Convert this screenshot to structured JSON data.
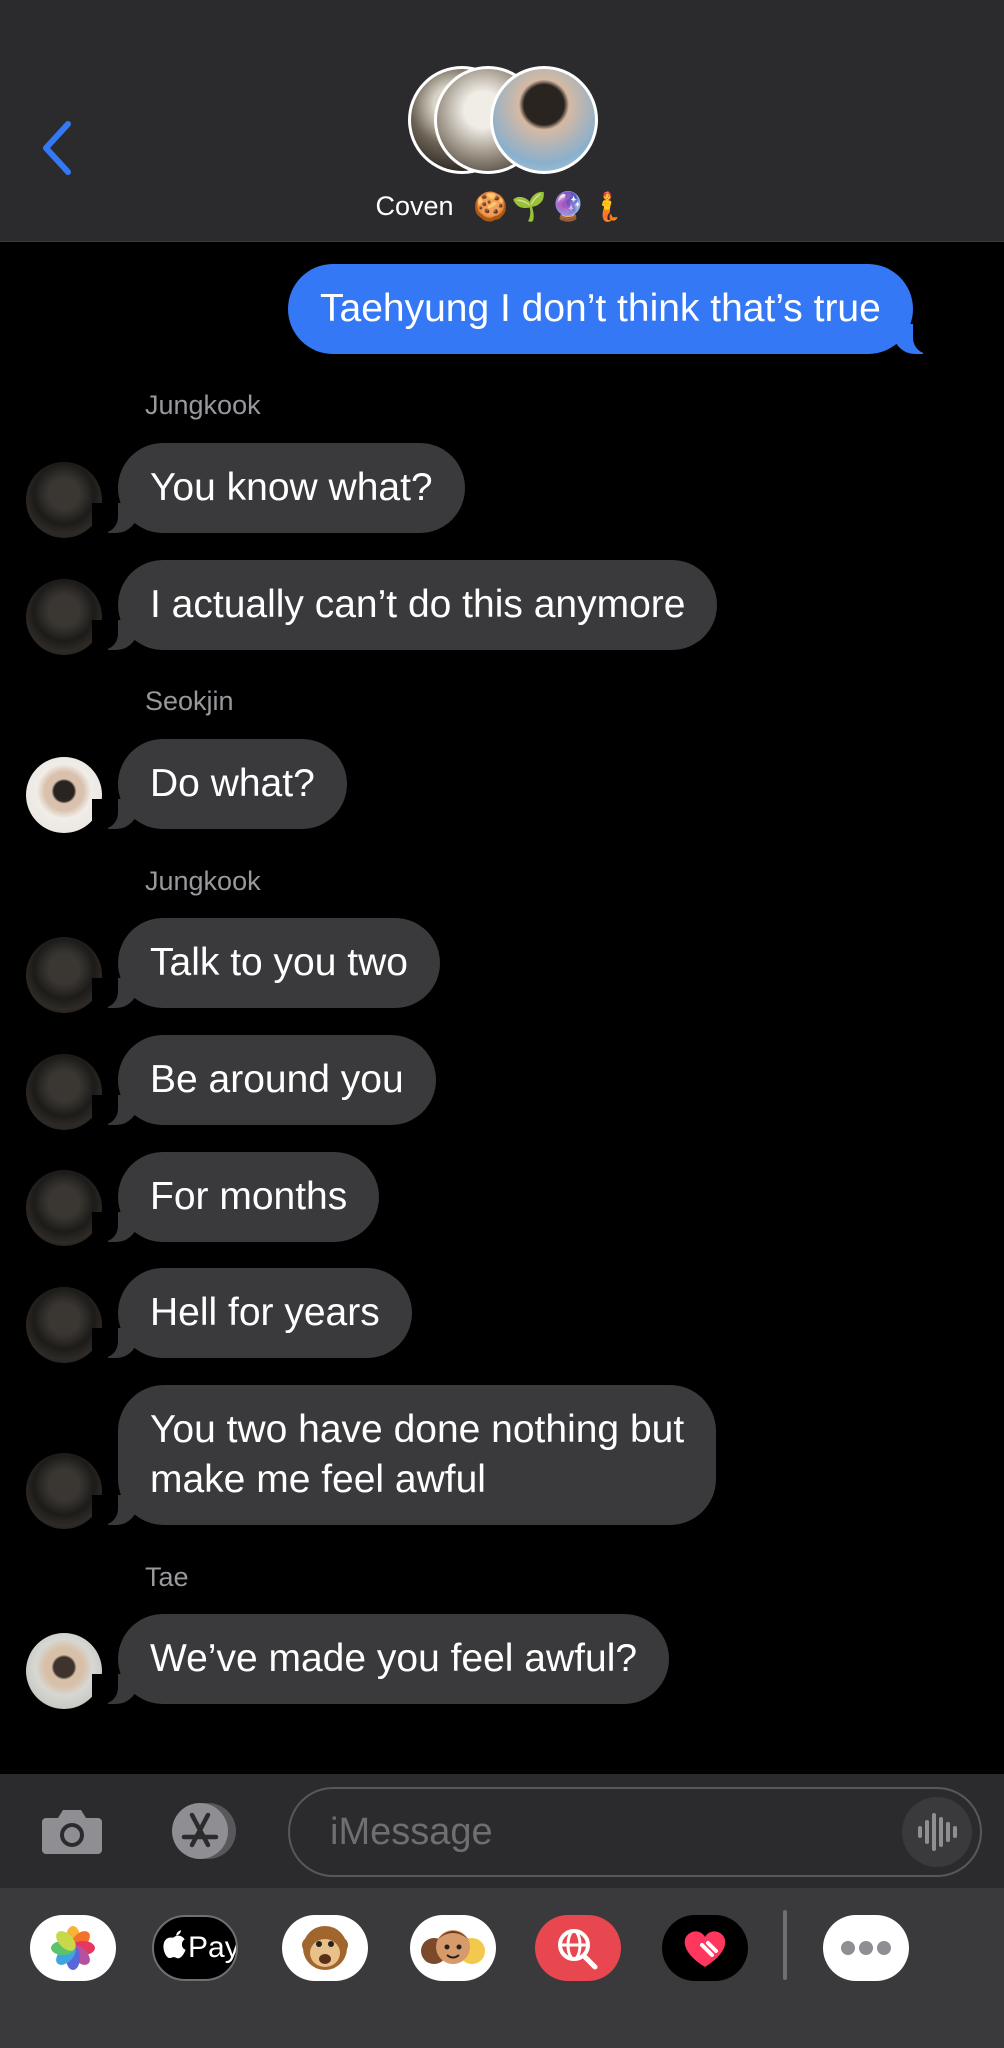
{
  "conversation": {
    "title": "Coven",
    "title_emojis": "🍪🌱🔮🧜"
  },
  "messages": [
    {
      "kind": "out",
      "text": "Taehyung I don’t think that’s true"
    },
    {
      "kind": "sender",
      "name": "Jungkook"
    },
    {
      "kind": "in",
      "text": "You know what?"
    },
    {
      "kind": "in",
      "text": "I actually can’t do this anymore"
    },
    {
      "kind": "sender",
      "name": "Seokjin"
    },
    {
      "kind": "in",
      "text": "Do what?"
    },
    {
      "kind": "sender",
      "name": "Jungkook"
    },
    {
      "kind": "in",
      "text": "Talk to you two"
    },
    {
      "kind": "in",
      "text": "Be around you"
    },
    {
      "kind": "in",
      "text": "For months"
    },
    {
      "kind": "in",
      "text": "Hell for years"
    },
    {
      "kind": "in",
      "text_line1": "You two have done nothing but",
      "text_line2": "make me feel awful"
    },
    {
      "kind": "sender",
      "name": "Tae"
    },
    {
      "kind": "in",
      "text": "We’ve made you feel awful?"
    }
  ],
  "input": {
    "placeholder": "iMessage",
    "value": ""
  },
  "app_drawer": {
    "apple_pay_label": "Pay"
  },
  "colors": {
    "header_bg": "#2b2b2d",
    "incoming_bubble": "#3a3a3c",
    "outgoing_bubble": "#3478f6",
    "accent": "#3478f6",
    "background": "#000000"
  }
}
